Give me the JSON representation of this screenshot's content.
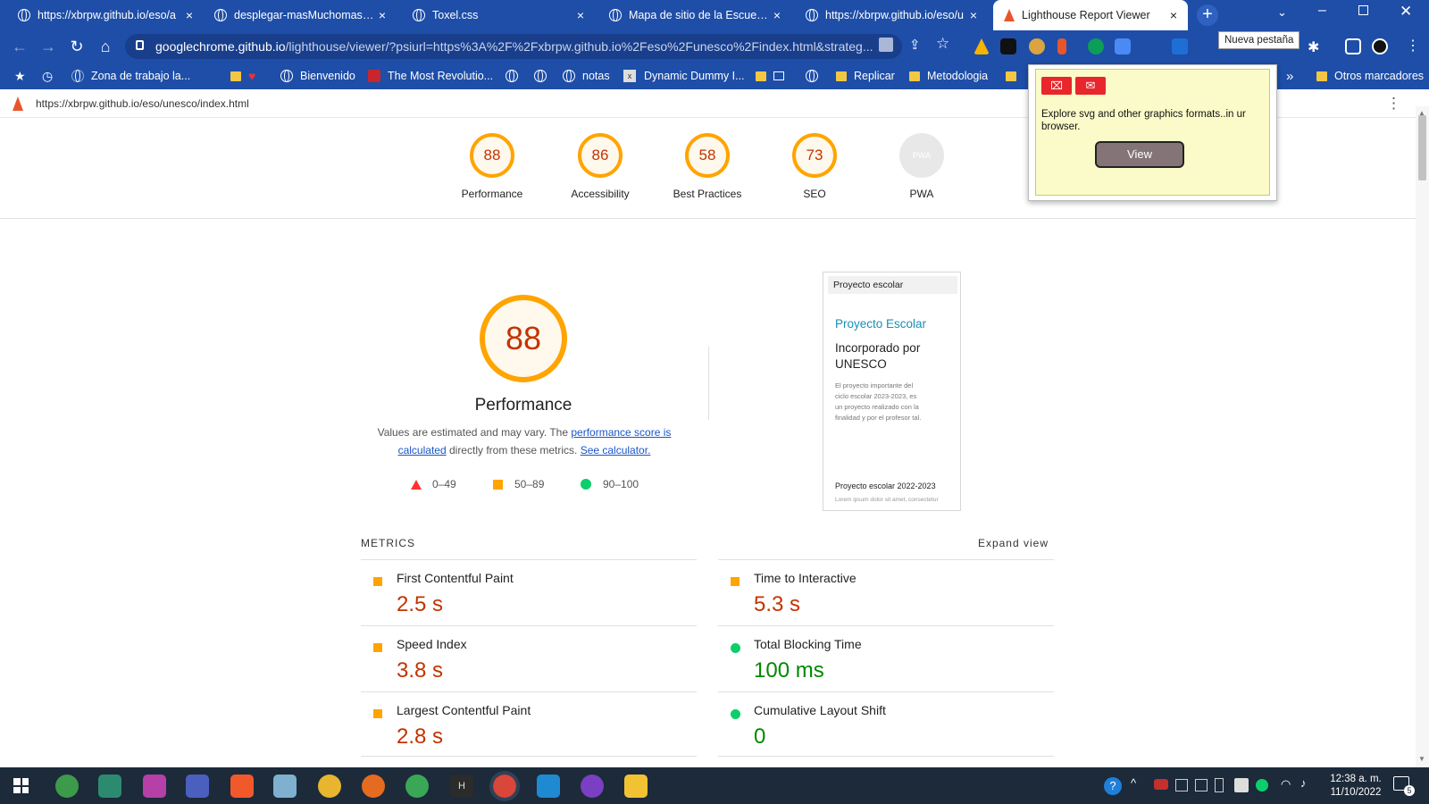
{
  "tabs": [
    {
      "title": "https://xbrpw.github.io/eso/a",
      "close": "×",
      "active": false
    },
    {
      "title": "desplegar-masMuchomas.htm",
      "close": "×",
      "active": false
    },
    {
      "title": "Toxel.css",
      "close": "×",
      "active": false
    },
    {
      "title": "Mapa de sitio de la Escuela Sr",
      "close": "×",
      "active": false
    },
    {
      "title": "https://xbrpw.github.io/eso/u",
      "close": "×",
      "active": false
    },
    {
      "title": "Lighthouse Report Viewer",
      "close": "×",
      "active": true
    }
  ],
  "new_tab_tooltip": "Nueva pestaña",
  "address": {
    "host": "googlechrome.github.io",
    "path": "/lighthouse/viewer/?psiurl=https%3A%2F%2Fxbrpw.github.io%2Feso%2Funesco%2Findex.html&strateg..."
  },
  "bookmarks": [
    {
      "label": "Zona de trabajo la...",
      "kind": "globe"
    },
    {
      "label": "Bienvenido",
      "kind": "globe"
    },
    {
      "label": "The Most Revolutio...",
      "kind": "site"
    },
    {
      "label": "notas",
      "kind": "globe"
    },
    {
      "label": "Dynamic Dummy I...",
      "kind": "site"
    },
    {
      "label": "Replicar",
      "kind": "folder"
    },
    {
      "label": "Metodologia",
      "kind": "folder"
    },
    {
      "label": "Otros marcadores",
      "kind": "folder"
    }
  ],
  "bookmarks_more": "»",
  "report_url": "https://xbrpw.github.io/eso/unesco/index.html",
  "categories": [
    {
      "score": "88",
      "label": "Performance",
      "level": 0.88
    },
    {
      "score": "86",
      "label": "Accessibility",
      "level": 0.86
    },
    {
      "score": "58",
      "label": "Best Practices",
      "level": 0.58
    },
    {
      "score": "73",
      "label": "SEO",
      "level": 0.73
    },
    {
      "score": "PWA",
      "label": "PWA",
      "level": 0
    }
  ],
  "performance": {
    "score": "88",
    "title": "Performance",
    "desc_prefix": "Values are estimated and may vary. The ",
    "desc_link": "performance score is calculated",
    "desc_mid": " directly from these metrics. ",
    "desc_link2": "See calculator.",
    "legend": [
      {
        "range": "0–49",
        "shape": "triangle"
      },
      {
        "range": "50–89",
        "shape": "square"
      },
      {
        "range": "90–100",
        "shape": "circle"
      }
    ]
  },
  "screenshot": {
    "header": "Proyecto escolar",
    "title": "Proyecto Escolar",
    "subtitle": "Incorporado por UNESCO",
    "body": "El proyecto importante del ciclo escolar 2023-2023, es un proyecto realizado con la finalidad y por el profesor tal.",
    "footer": "Proyecto escolar 2022-2023",
    "footer_sub": "Lorem ipsum dolor sit amet, consectetur"
  },
  "metrics_title": "METRICS",
  "expand_view": "Expand view",
  "metrics": [
    {
      "name": "First Contentful Paint",
      "value": "2.5 s",
      "rating": "average"
    },
    {
      "name": "Time to Interactive",
      "value": "5.3 s",
      "rating": "average"
    },
    {
      "name": "Speed Index",
      "value": "3.8 s",
      "rating": "average"
    },
    {
      "name": "Total Blocking Time",
      "value": "100 ms",
      "rating": "pass"
    },
    {
      "name": "Largest Contentful Paint",
      "value": "2.8 s",
      "rating": "average"
    },
    {
      "name": "Cumulative Layout Shift",
      "value": "0",
      "rating": "pass"
    }
  ],
  "popup": {
    "text": "Explore svg and other graphics formats..in ur browser.",
    "button": "View"
  },
  "clock": {
    "time": "12:38 a. m.",
    "date": "11/10/2022"
  },
  "notification_count": "5",
  "colors": {
    "chrome_blue": "#1e4ea8",
    "average": "#ffa400",
    "average_text": "#c33300",
    "pass": "#0cce6b",
    "pass_text": "#008800",
    "fail": "#ff3333"
  }
}
